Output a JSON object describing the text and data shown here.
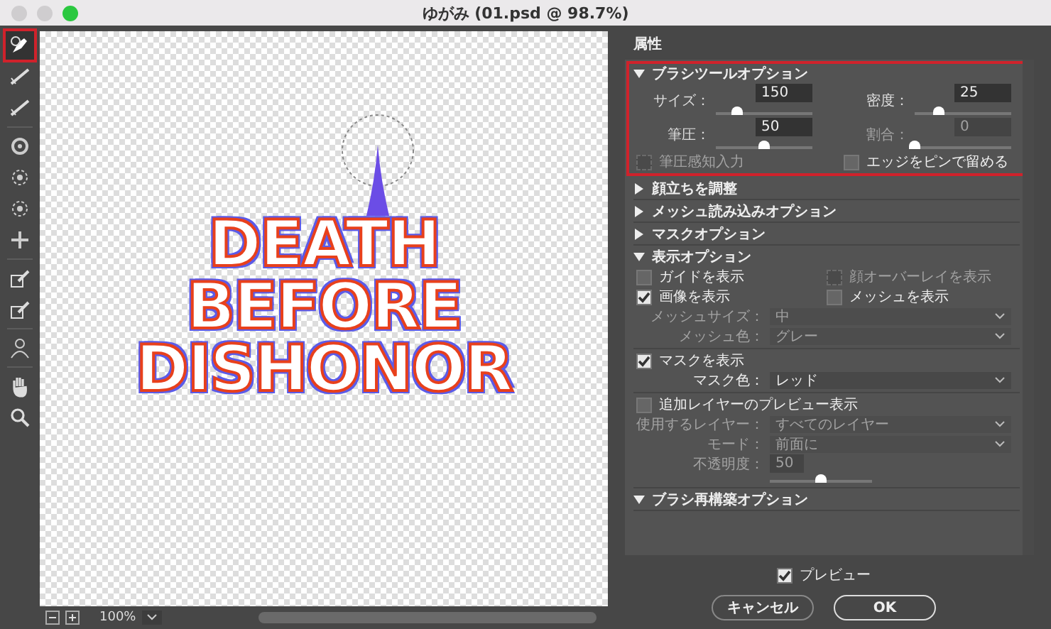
{
  "window": {
    "title": "ゆがみ (01.psd @ 98.7%)"
  },
  "tools": [
    {
      "kind": "warp",
      "selected": true
    },
    {
      "kind": "brush",
      "selected": false
    },
    {
      "kind": "smooth",
      "selected": false
    },
    {
      "kind": "twirl",
      "selected": false
    },
    {
      "kind": "pucker",
      "selected": false
    },
    {
      "kind": "bloat",
      "selected": false
    },
    {
      "kind": "push",
      "selected": false
    },
    {
      "kind": "freeze",
      "selected": false
    },
    {
      "kind": "thaw",
      "selected": false
    },
    {
      "kind": "face",
      "selected": false
    },
    {
      "kind": "hand",
      "selected": false
    },
    {
      "kind": "zoom",
      "selected": false
    }
  ],
  "canvas": {
    "artwork_lines": [
      "DEATH",
      "BEFORE",
      "DISHONOR"
    ],
    "zoom": "100%"
  },
  "panel": {
    "title": "属性",
    "sections": [
      {
        "label": "ブラシツールオプション",
        "expanded": true,
        "highlighted": true,
        "items": [
          {
            "kind": "sliders",
            "sliders": [
              {
                "label": "サイズ：",
                "value": "150",
                "level": 0.22,
                "disabled": false
              },
              {
                "label": "密度：",
                "value": "25",
                "level": 0.25,
                "disabled": false
              },
              {
                "label": "筆圧：",
                "value": "50",
                "level": 0.5,
                "disabled": false
              },
              {
                "label": "割合：",
                "value": "0",
                "level": 0,
                "disabled": true
              }
            ]
          },
          {
            "kind": "checks",
            "checks": [
              {
                "label": "筆圧感知入力",
                "checked": false,
                "disabled": true
              },
              {
                "label": "エッジをピンで留める",
                "checked": false,
                "disabled": false
              }
            ]
          }
        ]
      },
      {
        "label": "顔立ちを調整",
        "expanded": false
      },
      {
        "label": "メッシュ読み込みオプション",
        "expanded": false
      },
      {
        "label": "マスクオプション",
        "expanded": false
      },
      {
        "label": "表示オプション",
        "expanded": true,
        "items": [
          {
            "kind": "checks",
            "checks": [
              {
                "label": "ガイドを表示",
                "checked": false,
                "disabled": false
              },
              {
                "label": "顔オーバーレイを表示",
                "checked": false,
                "disabled": true
              }
            ]
          },
          {
            "kind": "checks",
            "checks": [
              {
                "label": "画像を表示",
                "checked": true,
                "disabled": false
              },
              {
                "label": "メッシュを表示",
                "checked": false,
                "disabled": false
              }
            ]
          },
          {
            "kind": "select",
            "label": "メッシュサイズ：",
            "value": "中",
            "disabled": true
          },
          {
            "kind": "select",
            "label": "メッシュ色：",
            "value": "グレー",
            "disabled": true
          },
          {
            "kind": "divider"
          },
          {
            "kind": "checks",
            "checks": [
              {
                "label": "マスクを表示",
                "checked": true,
                "disabled": false
              }
            ]
          },
          {
            "kind": "select",
            "label": "マスク色：",
            "value": "レッド",
            "disabled": false
          },
          {
            "kind": "divider"
          },
          {
            "kind": "checks",
            "checks": [
              {
                "label": "追加レイヤーのプレビュー表示",
                "checked": false,
                "disabled": false
              }
            ]
          },
          {
            "kind": "select",
            "label": "使用するレイヤー：",
            "value": "すべてのレイヤー",
            "disabled": true
          },
          {
            "kind": "select",
            "label": "モード：",
            "value": "前面に",
            "disabled": true
          },
          {
            "kind": "slider",
            "label": "不透明度：",
            "value": "50",
            "level": 0.5,
            "disabled": true
          }
        ]
      },
      {
        "label": "ブラシ再構築オプション",
        "expanded": true
      }
    ]
  },
  "footer": {
    "preview": {
      "label": "プレビュー",
      "checked": true
    },
    "cancel": "キャンセル",
    "ok": "OK"
  }
}
